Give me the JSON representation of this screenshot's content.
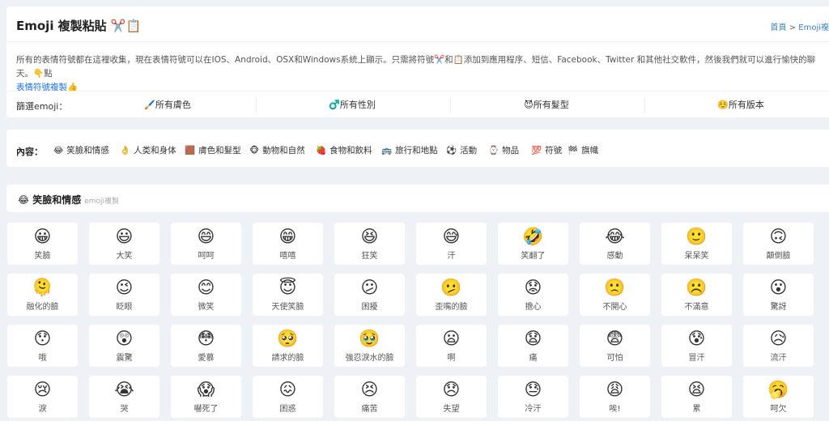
{
  "header": {
    "title": "Emoji 複製粘貼 ✂️📋",
    "breadcrumb_home": "首頁",
    "breadcrumb_sep": " > ",
    "breadcrumb_current": "Emoji複"
  },
  "intro": {
    "text": "所有的表情符號都在這裡收集，現在表情符號可以在IOS、Android、OSX和Windows系統上顯示。只需將符號✂️和📋添加到應用程序、短信、Facebook、Twitter 和其他社交軟件，然後我們就可以進行愉快的聊天。👇點",
    "link": "表情符號複製👍"
  },
  "filters": {
    "label": "篩選emoji：",
    "buttons": [
      {
        "icon": "🖌️",
        "label": "所有膚色"
      },
      {
        "icon": "♂️",
        "label": "所有性別"
      },
      {
        "icon": "😈",
        "label": "所有髮型"
      },
      {
        "icon": "☺️",
        "label": "所有版本"
      }
    ]
  },
  "categories": {
    "label": "內容：",
    "items": [
      {
        "icon": "😂",
        "label": "笑臉和情感"
      },
      {
        "icon": "👌",
        "label": "人类和身体"
      },
      {
        "icon": "🟫",
        "label": "膚色和髮型"
      },
      {
        "icon": "🐵",
        "label": "動物和自然"
      },
      {
        "icon": "🍓",
        "label": "食物和飲料"
      },
      {
        "icon": "🚌",
        "label": "旅行和地點"
      },
      {
        "icon": "⚽",
        "label": "活動"
      },
      {
        "icon": "⌚",
        "label": "物品"
      },
      {
        "icon": "💯",
        "label": "符號"
      },
      {
        "icon": "🏁",
        "label": "旗幟"
      }
    ]
  },
  "section": {
    "icon": "😂",
    "title": "笑臉和情感",
    "subtitle": "emoji複製"
  },
  "emojis": [
    {
      "glyph": "😀",
      "name": "笑臉"
    },
    {
      "glyph": "😃",
      "name": "大笑"
    },
    {
      "glyph": "😄",
      "name": "呵呵"
    },
    {
      "glyph": "😁",
      "name": "嘻嘻"
    },
    {
      "glyph": "😆",
      "name": "狂笑"
    },
    {
      "glyph": "😅",
      "name": "汗"
    },
    {
      "glyph": "🤣",
      "name": "笑翻了"
    },
    {
      "glyph": "😂",
      "name": "感動"
    },
    {
      "glyph": "🙂",
      "name": "呆呆笑"
    },
    {
      "glyph": "🙃",
      "name": "顛倒臉"
    },
    {
      "glyph": "🫠",
      "name": "融化的臉"
    },
    {
      "glyph": "😉",
      "name": "眨眼"
    },
    {
      "glyph": "😊",
      "name": "微笑"
    },
    {
      "glyph": "😇",
      "name": "天使笑臉"
    },
    {
      "glyph": "😕",
      "name": "困擾"
    },
    {
      "glyph": "🫤",
      "name": "歪嘴的臉"
    },
    {
      "glyph": "😟",
      "name": "擔心"
    },
    {
      "glyph": "🙁",
      "name": "不開心"
    },
    {
      "glyph": "☹️",
      "name": "不滿意"
    },
    {
      "glyph": "😮",
      "name": "驚訝"
    },
    {
      "glyph": "😯",
      "name": "哦"
    },
    {
      "glyph": "😲",
      "name": "震驚"
    },
    {
      "glyph": "😳",
      "name": "愛慕"
    },
    {
      "glyph": "🥺",
      "name": "請求的臉"
    },
    {
      "glyph": "🥹",
      "name": "強忍淚水的臉"
    },
    {
      "glyph": "😦",
      "name": "啊"
    },
    {
      "glyph": "😧",
      "name": "痛"
    },
    {
      "glyph": "😨",
      "name": "可怕"
    },
    {
      "glyph": "😰",
      "name": "冒汗"
    },
    {
      "glyph": "😥",
      "name": "流汗"
    },
    {
      "glyph": "😢",
      "name": "淚"
    },
    {
      "glyph": "😭",
      "name": "哭"
    },
    {
      "glyph": "😱",
      "name": "嚇死了"
    },
    {
      "glyph": "😖",
      "name": "困惑"
    },
    {
      "glyph": "😣",
      "name": "痛苦"
    },
    {
      "glyph": "😞",
      "name": "失望"
    },
    {
      "glyph": "😓",
      "name": "冷汗"
    },
    {
      "glyph": "😩",
      "name": "唉!"
    },
    {
      "glyph": "😫",
      "name": "累"
    },
    {
      "glyph": "🥱",
      "name": "呵欠"
    }
  ]
}
